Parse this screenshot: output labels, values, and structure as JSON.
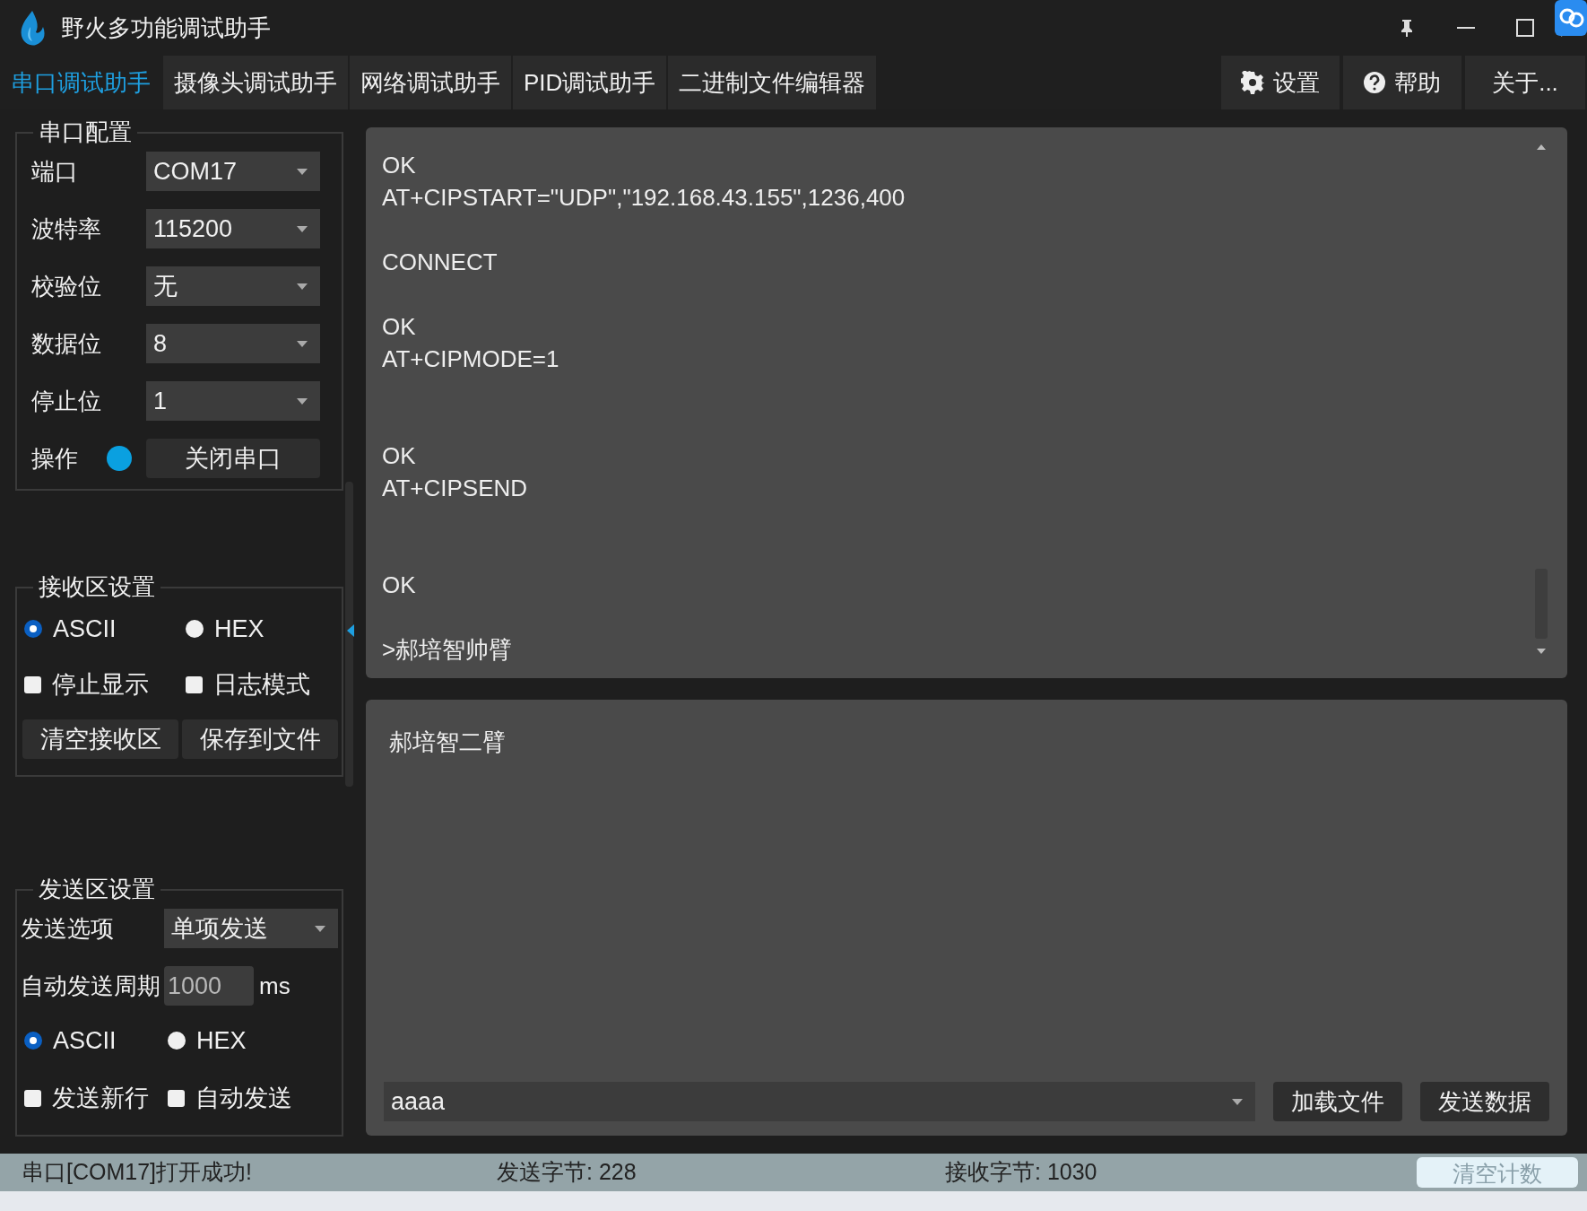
{
  "window": {
    "title": "野火多功能调试助手"
  },
  "tabs": [
    {
      "label": "串口调试助手",
      "selected": true
    },
    {
      "label": "摄像头调试助手",
      "selected": false
    },
    {
      "label": "网络调试助手",
      "selected": false
    },
    {
      "label": "PID调试助手",
      "selected": false
    },
    {
      "label": "二进制文件编辑器",
      "selected": false
    }
  ],
  "menu_buttons": [
    {
      "kind": "settings",
      "label": "设置"
    },
    {
      "kind": "help",
      "label": "帮助"
    },
    {
      "kind": "about",
      "label": "关于..."
    }
  ],
  "serial_config": {
    "title": "串口配置",
    "fields": [
      {
        "label": "端口",
        "value": "COM17"
      },
      {
        "label": "波特率",
        "value": "115200"
      },
      {
        "label": "校验位",
        "value": "无"
      },
      {
        "label": "数据位",
        "value": "8"
      },
      {
        "label": "停止位",
        "value": "1"
      }
    ],
    "operation": {
      "label": "操作",
      "on": true,
      "button": "关闭串口"
    }
  },
  "receive_settings": {
    "title": "接收区设置",
    "modes": [
      {
        "label": "ASCII",
        "selected": true
      },
      {
        "label": "HEX",
        "selected": false
      }
    ],
    "options": [
      {
        "label": "停止显示",
        "checked": false
      },
      {
        "label": "日志模式",
        "checked": false
      }
    ],
    "buttons": [
      "清空接收区",
      "保存到文件"
    ]
  },
  "send_settings": {
    "title": "发送区设置",
    "send_option": {
      "label": "发送选项",
      "value": "单项发送"
    },
    "period": {
      "label": "自动发送周期",
      "value": "1000",
      "unit": "ms"
    },
    "modes": [
      {
        "label": "ASCII",
        "selected": true
      },
      {
        "label": "HEX",
        "selected": false
      }
    ],
    "options": [
      {
        "label": "发送新行",
        "checked": false
      },
      {
        "label": "自动发送",
        "checked": false
      }
    ]
  },
  "receive_log": "OK\nAT+CIPSTART=\"UDP\",\"192.168.43.155\",1236,400\n\nCONNECT\n\nOK\nAT+CIPMODE=1\n\n\nOK\nAT+CIPSEND\n\n\nOK\n\n>郝培智帅臂",
  "send_text": "郝培智二臂",
  "send_history": {
    "value": "aaaa"
  },
  "send_buttons": [
    "加载文件",
    "发送数据"
  ],
  "status_bar": {
    "message": "串口[COM17]打开成功!",
    "sent": "发送字节: 228",
    "received": "接收字节: 1030",
    "button": "清空计数"
  }
}
